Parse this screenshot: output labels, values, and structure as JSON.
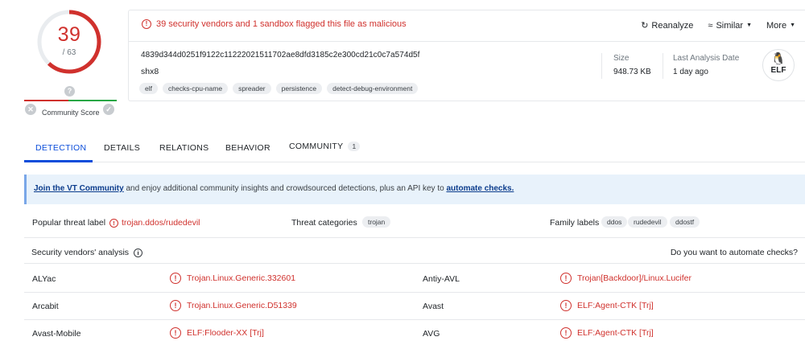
{
  "score": {
    "detected": "39",
    "total": "/ 63",
    "community_label": "Community Score",
    "fraction": 0.619
  },
  "colors": {
    "malicious": "#d0312d",
    "accent": "#0b4dda",
    "banner_bg": "#e8f2fb"
  },
  "header": {
    "alert": "39 security vendors and 1 sandbox flagged this file as malicious",
    "actions": {
      "reanalyze": "Reanalyze",
      "similar": "Similar",
      "more": "More"
    },
    "hash": "4839d344d0251f9122c11222021511702ae8dfd3185c2e300cd21c0c7a574d5f",
    "filename": "shx8",
    "tags": [
      "elf",
      "checks-cpu-name",
      "spreader",
      "persistence",
      "detect-debug-environment"
    ],
    "size_label": "Size",
    "size_value": "948.73 KB",
    "last_label": "Last Analysis Date",
    "last_value": "1 day ago",
    "filetype": "ELF"
  },
  "tabs": {
    "detection": "DETECTION",
    "details": "DETAILS",
    "relations": "RELATIONS",
    "behavior": "BEHAVIOR",
    "community": "COMMUNITY",
    "community_count": "1"
  },
  "banner": {
    "link1": "Join the VT Community",
    "text": " and enjoy additional community insights and crowdsourced detections, plus an API key to ",
    "link2": "automate checks."
  },
  "threat": {
    "popular_label": "Popular threat label",
    "popular_value": "trojan.ddos/rudedevil",
    "categories_label": "Threat categories",
    "categories": [
      "trojan"
    ],
    "family_label": "Family labels",
    "families": [
      "ddos",
      "rudedevil",
      "ddostf"
    ]
  },
  "vendors": {
    "title": "Security vendors' analysis",
    "automate": "Do you want to automate checks?",
    "rows": [
      {
        "v1": "ALYac",
        "r1": "Trojan.Linux.Generic.332601",
        "v2": "Antiy-AVL",
        "r2": "Trojan[Backdoor]/Linux.Lucifer"
      },
      {
        "v1": "Arcabit",
        "r1": "Trojan.Linux.Generic.D51339",
        "v2": "Avast",
        "r2": "ELF:Agent-CTK [Trj]"
      },
      {
        "v1": "Avast-Mobile",
        "r1": "ELF:Flooder-XX [Trj]",
        "v2": "AVG",
        "r2": "ELF:Agent-CTK [Trj]"
      }
    ]
  }
}
